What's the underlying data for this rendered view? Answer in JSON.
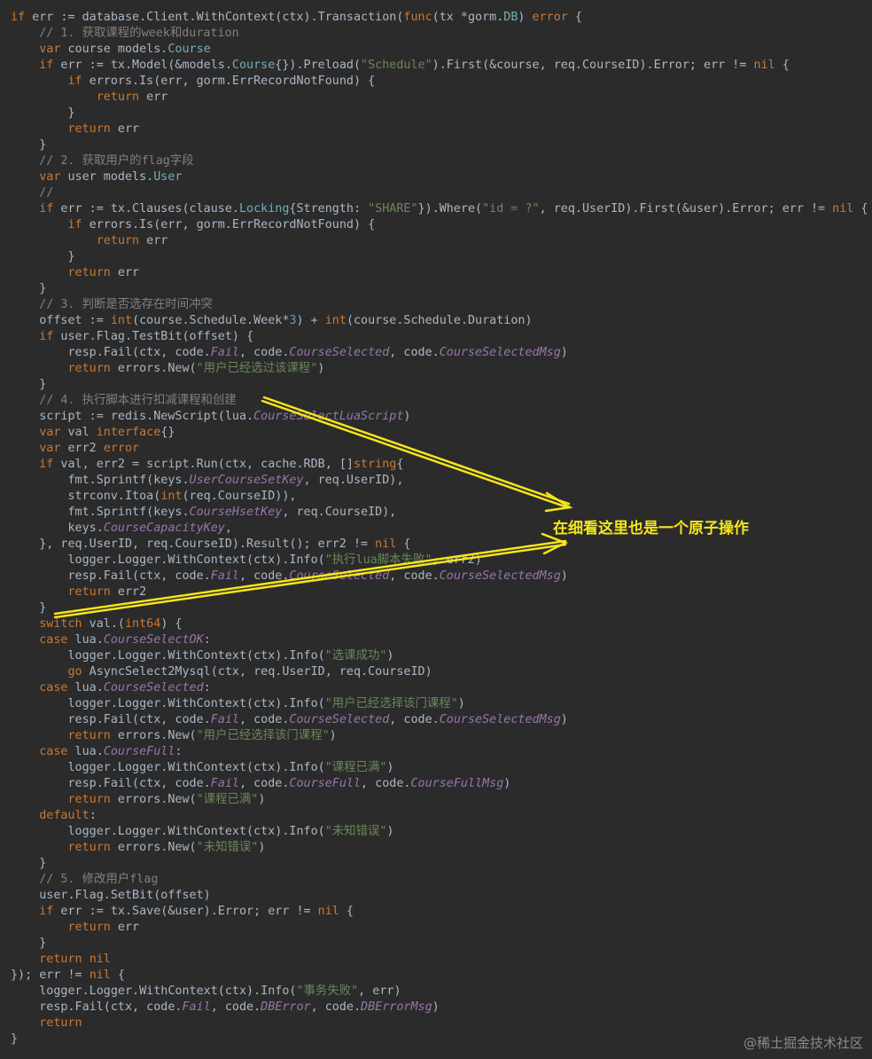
{
  "colors": {
    "background": "#2b2b2b",
    "keyword": "#cc7832",
    "number": "#6897bb",
    "string": "#6a8759",
    "comment": "#808080",
    "type": "#6fafbd",
    "constant": "#9876aa",
    "text": "#a9b7c6",
    "annotation": "#f5e51c"
  },
  "code_lines": [
    [
      [
        "kw",
        "if"
      ],
      [
        "p",
        " err := database.Client.WithContext(ctx).Transaction("
      ],
      [
        "kw",
        "func"
      ],
      [
        "p",
        "(tx *gorm."
      ],
      [
        "type",
        "DB"
      ],
      [
        "p",
        ") "
      ],
      [
        "kw",
        "error"
      ],
      [
        "p",
        " {"
      ]
    ],
    [
      [
        "p",
        "    "
      ],
      [
        "cmt",
        "// 1. 获取课程的week和duration"
      ]
    ],
    [
      [
        "p",
        "    "
      ],
      [
        "kw",
        "var"
      ],
      [
        "p",
        " course models."
      ],
      [
        "type",
        "Course"
      ]
    ],
    [
      [
        "p",
        "    "
      ],
      [
        "kw",
        "if"
      ],
      [
        "p",
        " err := tx.Model(&models."
      ],
      [
        "type",
        "Course"
      ],
      [
        "p",
        "{}).Preload("
      ],
      [
        "str",
        "\"Schedule\""
      ],
      [
        "p",
        ").First(&course, req.CourseID).Error; err != "
      ],
      [
        "kw",
        "nil"
      ],
      [
        "p",
        " {"
      ]
    ],
    [
      [
        "p",
        "        "
      ],
      [
        "kw",
        "if"
      ],
      [
        "p",
        " errors.Is(err, gorm.ErrRecordNotFound) {"
      ]
    ],
    [
      [
        "p",
        "            "
      ],
      [
        "kw",
        "return"
      ],
      [
        "p",
        " err"
      ]
    ],
    [
      [
        "p",
        "        }"
      ]
    ],
    [
      [
        "p",
        "        "
      ],
      [
        "kw",
        "return"
      ],
      [
        "p",
        " err"
      ]
    ],
    [
      [
        "p",
        "    }"
      ]
    ],
    [
      [
        "p",
        "    "
      ],
      [
        "cmt",
        "// 2. 获取用户的flag字段"
      ]
    ],
    [
      [
        "p",
        "    "
      ],
      [
        "kw",
        "var"
      ],
      [
        "p",
        " user models."
      ],
      [
        "type",
        "User"
      ]
    ],
    [
      [
        "p",
        "    "
      ],
      [
        "cmt",
        "//"
      ]
    ],
    [
      [
        "p",
        "    "
      ],
      [
        "kw",
        "if"
      ],
      [
        "p",
        " err := tx.Clauses(clause."
      ],
      [
        "type",
        "Locking"
      ],
      [
        "p",
        "{Strength: "
      ],
      [
        "str",
        "\"SHARE\""
      ],
      [
        "p",
        "}).Where("
      ],
      [
        "str",
        "\"id = ?\""
      ],
      [
        "p",
        ", req.UserID).First(&user).Error; err != "
      ],
      [
        "kw",
        "nil"
      ],
      [
        "p",
        " {"
      ]
    ],
    [
      [
        "p",
        "        "
      ],
      [
        "kw",
        "if"
      ],
      [
        "p",
        " errors.Is(err, gorm.ErrRecordNotFound) {"
      ]
    ],
    [
      [
        "p",
        "            "
      ],
      [
        "kw",
        "return"
      ],
      [
        "p",
        " err"
      ]
    ],
    [
      [
        "p",
        "        }"
      ]
    ],
    [
      [
        "p",
        "        "
      ],
      [
        "kw",
        "return"
      ],
      [
        "p",
        " err"
      ]
    ],
    [
      [
        "p",
        "    }"
      ]
    ],
    [
      [
        "p",
        "    "
      ],
      [
        "cmt",
        "// 3. 判断是否选存在时间冲突"
      ]
    ],
    [
      [
        "p",
        "    offset := "
      ],
      [
        "kw",
        "int"
      ],
      [
        "p",
        "(course.Schedule.Week*"
      ],
      [
        "num",
        "3"
      ],
      [
        "p",
        ") + "
      ],
      [
        "kw",
        "int"
      ],
      [
        "p",
        "(course.Schedule.Duration)"
      ]
    ],
    [
      [
        "p",
        "    "
      ],
      [
        "kw",
        "if"
      ],
      [
        "p",
        " user.Flag.TestBit(offset) {"
      ]
    ],
    [
      [
        "p",
        "        resp.Fail(ctx, code."
      ],
      [
        "const",
        "Fail"
      ],
      [
        "p",
        ", code."
      ],
      [
        "const",
        "CourseSelected"
      ],
      [
        "p",
        ", code."
      ],
      [
        "const",
        "CourseSelectedMsg"
      ],
      [
        "p",
        ")"
      ]
    ],
    [
      [
        "p",
        "        "
      ],
      [
        "kw",
        "return"
      ],
      [
        "p",
        " errors.New("
      ],
      [
        "str",
        "\"用户已经选过该课程\""
      ],
      [
        "p",
        ")"
      ]
    ],
    [
      [
        "p",
        "    }"
      ]
    ],
    [
      [
        "p",
        "    "
      ],
      [
        "cmt",
        "// 4. 执行脚本进行扣减课程和创建"
      ]
    ],
    [
      [
        "p",
        "    script := redis.NewScript(lua."
      ],
      [
        "const",
        "CourseSelectLuaScript"
      ],
      [
        "p",
        ")"
      ]
    ],
    [
      [
        "p",
        "    "
      ],
      [
        "kw",
        "var"
      ],
      [
        "p",
        " val "
      ],
      [
        "kw",
        "interface"
      ],
      [
        "p",
        "{}"
      ]
    ],
    [
      [
        "p",
        "    "
      ],
      [
        "kw",
        "var"
      ],
      [
        "p",
        " err2 "
      ],
      [
        "kw",
        "error"
      ]
    ],
    [
      [
        "p",
        "    "
      ],
      [
        "kw",
        "if"
      ],
      [
        "p",
        " val, err2 = script.Run(ctx, cache.RDB, []"
      ],
      [
        "kw",
        "string"
      ],
      [
        "p",
        "{"
      ]
    ],
    [
      [
        "p",
        "        fmt.Sprintf(keys."
      ],
      [
        "const",
        "UserCourseSetKey"
      ],
      [
        "p",
        ", req.UserID),"
      ]
    ],
    [
      [
        "p",
        "        strconv.Itoa("
      ],
      [
        "kw",
        "int"
      ],
      [
        "p",
        "(req.CourseID)),"
      ]
    ],
    [
      [
        "p",
        "        fmt.Sprintf(keys."
      ],
      [
        "const",
        "CourseHsetKey"
      ],
      [
        "p",
        ", req.CourseID),"
      ]
    ],
    [
      [
        "p",
        "        keys."
      ],
      [
        "const",
        "CourseCapacityKey"
      ],
      [
        "p",
        ","
      ]
    ],
    [
      [
        "p",
        "    }, req.UserID, req.CourseID).Result(); err2 != "
      ],
      [
        "kw",
        "nil"
      ],
      [
        "p",
        " {"
      ]
    ],
    [
      [
        "p",
        "        logger.Logger.WithContext(ctx).Info("
      ],
      [
        "str",
        "\"执行lua脚本失败\""
      ],
      [
        "p",
        ", err2)"
      ]
    ],
    [
      [
        "p",
        "        resp.Fail(ctx, code."
      ],
      [
        "const",
        "Fail"
      ],
      [
        "p",
        ", code."
      ],
      [
        "const",
        "CourseSelected"
      ],
      [
        "p",
        ", code."
      ],
      [
        "const",
        "CourseSelectedMsg"
      ],
      [
        "p",
        ")"
      ]
    ],
    [
      [
        "p",
        "        "
      ],
      [
        "kw",
        "return"
      ],
      [
        "p",
        " err2"
      ]
    ],
    [
      [
        "p",
        "    }"
      ]
    ],
    [
      [
        "p",
        "    "
      ],
      [
        "kw",
        "switch"
      ],
      [
        "p",
        " val.("
      ],
      [
        "kw",
        "int64"
      ],
      [
        "p",
        ") {"
      ]
    ],
    [
      [
        "p",
        "    "
      ],
      [
        "kw",
        "case"
      ],
      [
        "p",
        " lua."
      ],
      [
        "const",
        "CourseSelectOK"
      ],
      [
        "p",
        ":"
      ]
    ],
    [
      [
        "p",
        "        logger.Logger.WithContext(ctx).Info("
      ],
      [
        "str",
        "\"选课成功\""
      ],
      [
        "p",
        ")"
      ]
    ],
    [
      [
        "p",
        "        "
      ],
      [
        "kw",
        "go"
      ],
      [
        "p",
        " AsyncSelect2Mysql(ctx, req.UserID, req.CourseID)"
      ]
    ],
    [
      [
        "p",
        "    "
      ],
      [
        "kw",
        "case"
      ],
      [
        "p",
        " lua."
      ],
      [
        "const",
        "CourseSelected"
      ],
      [
        "p",
        ":"
      ]
    ],
    [
      [
        "p",
        "        logger.Logger.WithContext(ctx).Info("
      ],
      [
        "str",
        "\"用户已经选择该门课程\""
      ],
      [
        "p",
        ")"
      ]
    ],
    [
      [
        "p",
        "        resp.Fail(ctx, code."
      ],
      [
        "const",
        "Fail"
      ],
      [
        "p",
        ", code."
      ],
      [
        "const",
        "CourseSelected"
      ],
      [
        "p",
        ", code."
      ],
      [
        "const",
        "CourseSelectedMsg"
      ],
      [
        "p",
        ")"
      ]
    ],
    [
      [
        "p",
        "        "
      ],
      [
        "kw",
        "return"
      ],
      [
        "p",
        " errors.New("
      ],
      [
        "str",
        "\"用户已经选择该门课程\""
      ],
      [
        "p",
        ")"
      ]
    ],
    [
      [
        "p",
        "    "
      ],
      [
        "kw",
        "case"
      ],
      [
        "p",
        " lua."
      ],
      [
        "const",
        "CourseFull"
      ],
      [
        "p",
        ":"
      ]
    ],
    [
      [
        "p",
        "        logger.Logger.WithContext(ctx).Info("
      ],
      [
        "str",
        "\"课程已满\""
      ],
      [
        "p",
        ")"
      ]
    ],
    [
      [
        "p",
        "        resp.Fail(ctx, code."
      ],
      [
        "const",
        "Fail"
      ],
      [
        "p",
        ", code."
      ],
      [
        "const",
        "CourseFull"
      ],
      [
        "p",
        ", code."
      ],
      [
        "const",
        "CourseFullMsg"
      ],
      [
        "p",
        ")"
      ]
    ],
    [
      [
        "p",
        "        "
      ],
      [
        "kw",
        "return"
      ],
      [
        "p",
        " errors.New("
      ],
      [
        "str",
        "\"课程已满\""
      ],
      [
        "p",
        ")"
      ]
    ],
    [
      [
        "p",
        "    "
      ],
      [
        "kw",
        "default"
      ],
      [
        "p",
        ":"
      ]
    ],
    [
      [
        "p",
        "        logger.Logger.WithContext(ctx).Info("
      ],
      [
        "str",
        "\"未知错误\""
      ],
      [
        "p",
        ")"
      ]
    ],
    [
      [
        "p",
        "        "
      ],
      [
        "kw",
        "return"
      ],
      [
        "p",
        " errors.New("
      ],
      [
        "str",
        "\"未知错误\""
      ],
      [
        "p",
        ")"
      ]
    ],
    [
      [
        "p",
        "    }"
      ]
    ],
    [
      [
        "p",
        "    "
      ],
      [
        "cmt",
        "// 5. 修改用户flag"
      ]
    ],
    [
      [
        "p",
        "    user.Flag.SetBit(offset)"
      ]
    ],
    [
      [
        "p",
        "    "
      ],
      [
        "kw",
        "if"
      ],
      [
        "p",
        " err := tx.Save(&user).Error; err != "
      ],
      [
        "kw",
        "nil"
      ],
      [
        "p",
        " {"
      ]
    ],
    [
      [
        "p",
        "        "
      ],
      [
        "kw",
        "return"
      ],
      [
        "p",
        " err"
      ]
    ],
    [
      [
        "p",
        "    }"
      ]
    ],
    [
      [
        "p",
        "    "
      ],
      [
        "kw",
        "return"
      ],
      [
        "p",
        " "
      ],
      [
        "kw",
        "nil"
      ]
    ],
    [
      [
        "p",
        "}); err != "
      ],
      [
        "kw",
        "nil"
      ],
      [
        "p",
        " {"
      ]
    ],
    [
      [
        "p",
        "    logger.Logger.WithContext(ctx).Info("
      ],
      [
        "str",
        "\"事务失败\""
      ],
      [
        "p",
        ", err)"
      ]
    ],
    [
      [
        "p",
        "    resp.Fail(ctx, code."
      ],
      [
        "const",
        "Fail"
      ],
      [
        "p",
        ", code."
      ],
      [
        "const",
        "DBError"
      ],
      [
        "p",
        ", code."
      ],
      [
        "const",
        "DBErrorMsg"
      ],
      [
        "p",
        ")"
      ]
    ],
    [
      [
        "p",
        "    "
      ],
      [
        "kw",
        "return"
      ]
    ],
    [
      [
        "p",
        "}"
      ]
    ]
  ],
  "annotation": {
    "callout_text": "在细看这里也是一个原子操作"
  },
  "watermark": {
    "text": "@稀土掘金技术社区"
  }
}
